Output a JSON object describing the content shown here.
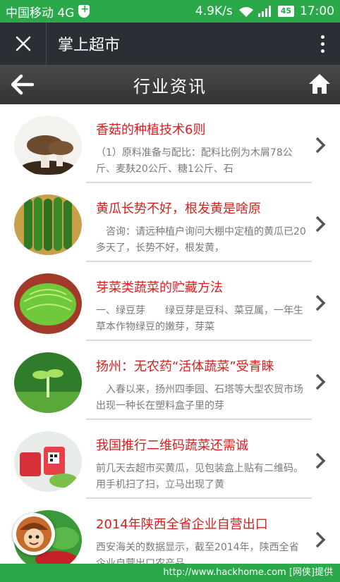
{
  "status_bar": {
    "carrier": "中国移动 4G",
    "speed": "4.9K/s",
    "battery": "45",
    "time": "17:00"
  },
  "app_bar": {
    "title": "掌上超市"
  },
  "page_header": {
    "title": "行业资讯"
  },
  "articles": [
    {
      "title": "香菇的种植技术6则",
      "summary": "（1）原料准备与配比：配料比例为木屑78公斤、麦麸20公斤、糖1公斤、石",
      "thumb": "mushroom"
    },
    {
      "title": "黄瓜长势不好，根发黄是啥原",
      "summary": "　咨询：请远种植户询问大棚中定植的黄瓜已20多天了，长势不好，根发黄，",
      "thumb": "cucumber"
    },
    {
      "title": "芽菜类蔬菜的贮藏方法",
      "summary": "一、绿豆芽　　绿豆芽是豆科、菜豆属，一年生草本作物绿豆的嫩芽，芽菜",
      "thumb": "sprouts"
    },
    {
      "title": "扬州：无农药“活体蔬菜”受青睐",
      "summary": "　入春以来，扬州四季园、石塔等大型农贸市场出现一种长在塑料盒子里的芽",
      "thumb": "seedling"
    },
    {
      "title": "我国推行二维码蔬菜还需诚",
      "summary": "前几天去超市买黄瓜，见包装盒上贴有二维码。用手机扫了扫，立马出现了黄",
      "thumb": "qrcode-veg"
    },
    {
      "title": "2014年陕西全省企业自营出口",
      "summary": "西安海关的数据显示，截至2014年，陕西全省企业自营出口农产品",
      "thumb": "produce"
    }
  ],
  "footer": {
    "watermark": "http://www.hackhome.com [网侠]提供"
  }
}
